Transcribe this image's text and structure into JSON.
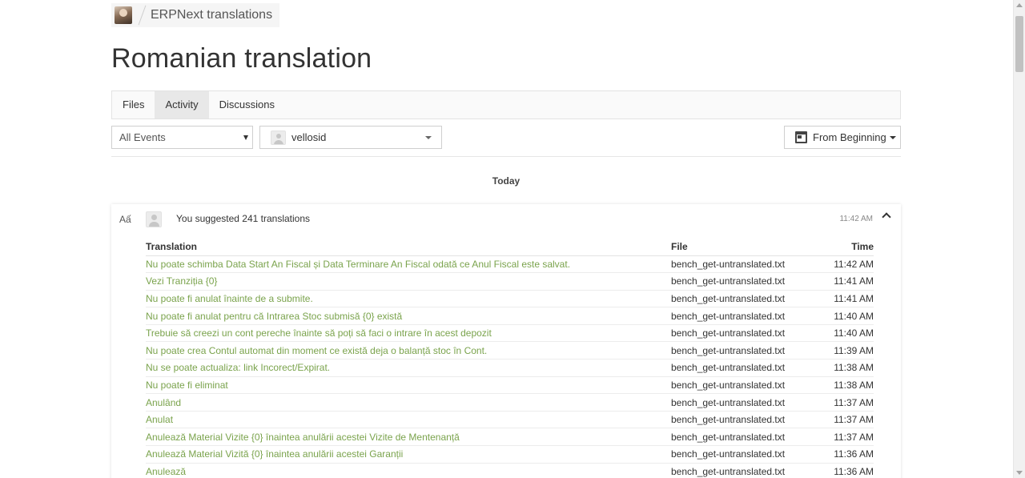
{
  "breadcrumb": {
    "project": "ERPNext translations"
  },
  "page": {
    "title": "Romanian translation"
  },
  "tabs": [
    {
      "label": "Files",
      "active": false
    },
    {
      "label": "Activity",
      "active": true
    },
    {
      "label": "Discussions",
      "active": false
    }
  ],
  "filters": {
    "events_selected": "All Events",
    "user_selected": "vellosid",
    "date_range": "From Beginning"
  },
  "timeline": {
    "day_label": "Today",
    "event": {
      "icon": "translate-icon",
      "icon_glyph": "Aấ",
      "summary": "You suggested 241 translations",
      "time": "11:42 AM",
      "columns": {
        "translation": "Translation",
        "file": "File",
        "time": "Time"
      },
      "rows": [
        {
          "translation": "Nu poate schimba Data Start An Fiscal și Data Terminare An Fiscal odată ce Anul Fiscal este salvat.",
          "file": "bench_get-untranslated.txt",
          "time": "11:42 AM"
        },
        {
          "translation": "Vezi Tranziția {0}",
          "file": "bench_get-untranslated.txt",
          "time": "11:41 AM"
        },
        {
          "translation": "Nu poate fi anulat înainte de a submite.",
          "file": "bench_get-untranslated.txt",
          "time": "11:41 AM"
        },
        {
          "translation": "Nu poate fi anulat pentru că Intrarea Stoc submisă {0} există",
          "file": "bench_get-untranslated.txt",
          "time": "11:40 AM"
        },
        {
          "translation": "Trebuie să creezi un cont pereche înainte să poți să faci o intrare în acest depozit",
          "file": "bench_get-untranslated.txt",
          "time": "11:40 AM"
        },
        {
          "translation": "Nu poate crea Contul automat din moment ce există deja o balanță stoc în Cont.",
          "file": "bench_get-untranslated.txt",
          "time": "11:39 AM"
        },
        {
          "translation": "Nu se poate actualiza: link Incorect/Expirat.",
          "file": "bench_get-untranslated.txt",
          "time": "11:38 AM"
        },
        {
          "translation": "Nu poate fi eliminat",
          "file": "bench_get-untranslated.txt",
          "time": "11:38 AM"
        },
        {
          "translation": "Anulând",
          "file": "bench_get-untranslated.txt",
          "time": "11:37 AM"
        },
        {
          "translation": "Anulat",
          "file": "bench_get-untranslated.txt",
          "time": "11:37 AM"
        },
        {
          "translation": "Anulează Material Vizite {0} înaintea anulării acestei Vizite de Mentenanță",
          "file": "bench_get-untranslated.txt",
          "time": "11:37 AM"
        },
        {
          "translation": "Anulează Material Vizită {0} înaintea anulării acestei Garanții",
          "file": "bench_get-untranslated.txt",
          "time": "11:36 AM"
        },
        {
          "translation": "Anulează",
          "file": "bench_get-untranslated.txt",
          "time": "11:36 AM"
        }
      ]
    }
  },
  "colors": {
    "translation_link": "#7aa34c",
    "text": "#333333",
    "border": "#e3e3e3"
  }
}
